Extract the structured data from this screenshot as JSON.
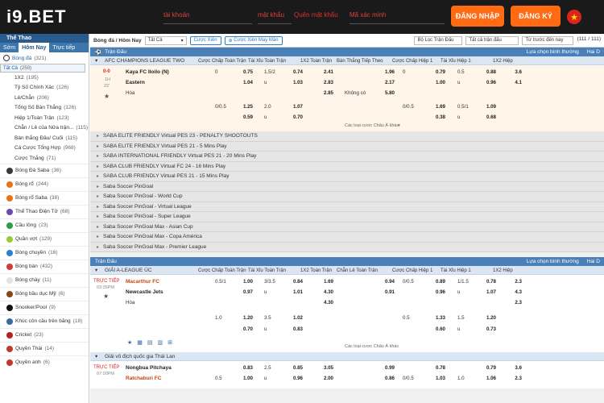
{
  "header": {
    "logo": "i9.BET",
    "username_placeholder": "tài khoản",
    "password_placeholder": "mật khẩu",
    "forgot_label": "Quên mật khẩu",
    "code_placeholder": "Mã xác minh",
    "login_label": "ĐĂNG NHẬP",
    "register_label": "ĐĂNG KÝ",
    "flag_icon": "star-icon"
  },
  "sidebar": {
    "title": "Thể Thao",
    "tabs": [
      "Sớm",
      "Hôm Nay",
      "Trực tiếp"
    ],
    "football_label": "Bóng đá",
    "football_count": "(321)",
    "sub": [
      {
        "label": "Tất Cả",
        "count": "(250)"
      },
      {
        "label": "1X2",
        "count": "(195)"
      },
      {
        "label": "Tỷ Số Chính Xác",
        "count": "(126)"
      },
      {
        "label": "Lẻ/Chẵn",
        "count": "(206)"
      },
      {
        "label": "Tổng Số Bàn Thắng",
        "count": "(126)"
      },
      {
        "label": "Hiệp 1/Toàn Trận",
        "count": "(123)"
      },
      {
        "label": "Chẵn / Lẻ của Nửa trận...",
        "count": "(115)"
      },
      {
        "label": "Bàn thắng Đầu/ Cuối",
        "count": "(115)"
      },
      {
        "label": "Cá Cược Tổng Hợp",
        "count": "(968)"
      },
      {
        "label": "Cược Thắng",
        "count": "(71)"
      }
    ],
    "sports": [
      {
        "label": "Bóng Đá Saba",
        "count": "(36)",
        "color": "#3a3a3a"
      },
      {
        "label": "Bóng rổ",
        "count": "(244)",
        "color": "#e8731a"
      },
      {
        "label": "Bóng rổ Saba",
        "count": "(38)",
        "color": "#e8731a"
      },
      {
        "label": "Thể Thao Điện Tử",
        "count": "(68)",
        "color": "#6a4caf"
      },
      {
        "label": "Cầu lông",
        "count": "(23)",
        "color": "#2a9d4a"
      },
      {
        "label": "Quần vợt",
        "count": "(129)",
        "color": "#9acd32"
      },
      {
        "label": "Bóng chuyền",
        "count": "(16)",
        "color": "#2d7fd0"
      },
      {
        "label": "Bóng bàn",
        "count": "(432)",
        "color": "#d23b3b"
      },
      {
        "label": "Bóng chày",
        "count": "(11)",
        "color": "#e2e2e2"
      },
      {
        "label": "Bóng bầu dục Mỹ",
        "count": "(6)",
        "color": "#8b4513"
      },
      {
        "label": "Snooker/Pool",
        "count": "(9)",
        "color": "#111111"
      },
      {
        "label": "Khúc côn cầu trên băng",
        "count": "(18)",
        "color": "#3a6aa0"
      },
      {
        "label": "Cricket",
        "count": "(23)",
        "color": "#b22222"
      },
      {
        "label": "Quyền Thái",
        "count": "(14)",
        "color": "#c0392b"
      },
      {
        "label": "Quyền anh",
        "count": "(6)",
        "color": "#c0392b"
      }
    ]
  },
  "toolbar": {
    "breadcrumb": "Bóng đá / Hôm Nay",
    "filter_all": "Tất Cả",
    "parlay": "Cược Xiên",
    "parlay_lucky": "Cược Xiên May Mắn",
    "league_filter": "Bộ Lọc Trận Đấu",
    "all_matches": "Tất cả trận đấu",
    "sort": "Từ trước đến nay",
    "count": "(111 / 111)"
  },
  "sections": {
    "live1": "Trận Đấu",
    "live2": "Trận Đấu",
    "odds_type": "Lựa chọn bình thường",
    "odds_type2": "Hai D"
  },
  "columns": [
    "Cược Chấp Toàn Trận",
    "Tài Xỉu Toàn Trận",
    "1X2 Toàn Trận",
    "Bàn Thắng Tiếp Theo",
    "Cược Chấp Hiệp 1",
    "Tài Xỉu Hiệp 1",
    "1X2 Hiệp"
  ],
  "columns2": [
    "Cược Chấp Toàn Trận",
    "Tài Xỉu Toàn Trận",
    "1X2 Toàn Trận",
    "Chẵn Lẻ Toàn Trận",
    "Cược Chấp Hiệp 1",
    "Tài Xỉu Hiệp 1",
    "1X2 Hiệp"
  ],
  "match1": {
    "league": "AFC CHAMPIONS LEAGUE TWO",
    "score": "0-0",
    "half": "1H",
    "minute": "22'",
    "home": "Kaya FC Iloilo (N)",
    "away": "Eastern",
    "draw": "Hòa",
    "more": "Các loại cược Châu Á khác",
    "r1": [
      "0",
      "0.75",
      "1.5/2",
      "0.74",
      "2.41",
      "1.96",
      "0",
      "0.79",
      "0.5",
      "0.88",
      "3.6"
    ],
    "r2": [
      "",
      "1.04",
      "u",
      "1.03",
      "2.83",
      "2.17",
      "",
      "1.00",
      "u",
      "0.96",
      "4.1"
    ],
    "r3": [
      "2.85",
      "Không có",
      "5.80"
    ],
    "r4": [
      "0/0.5",
      "1.25",
      "2.0",
      "1.07",
      "0/0.5",
      "1.69",
      "0.5/1",
      "1.09"
    ],
    "r5": [
      "0.59",
      "u",
      "0.70",
      "0.38",
      "u",
      "0.68"
    ]
  },
  "groups": [
    "SABA ELITE FRIENDLY Virtual PES 23 - PENALTY SHOOTOUTS",
    "SABA ELITE FRIENDLY Virtual PES 21 - 5 Mins Play",
    "SABA INTERNATIONAL FRIENDLY Virtual PES 21 - 20 Mins Play",
    "SABA CLUB FRIENDLY Virtual FC 24 - 16 Mins Play",
    "SABA CLUB FRIENDLY Virtual PES 21 - 15 Mins Play",
    "Saba Soccer PinGoal",
    "Saba Soccer PinGoal - World Cup",
    "Saba Soccer PinGoal - Virtual League",
    "Saba Soccer PinGoal - Super League",
    "Saba Soccer PinGoal Max - Asian Cup",
    "Saba Soccer PinGoal Max - Copa América",
    "Saba Soccer PinGoal Max - Premier League"
  ],
  "match2": {
    "league": "GIẢI A-LEAGUE ÚC",
    "live": "TRỰC TIẾP",
    "time": "03:35PM",
    "home": "Macarthur FC",
    "away": "Newcastle Jets",
    "draw": "Hòa",
    "more": "Các loại cược Châu Á khác",
    "r1": [
      "0.5/1",
      "1.00",
      "3/3.5",
      "0.84",
      "1.69",
      "0.94",
      "0/0.5",
      "0.89",
      "1/1.5",
      "0.78",
      "2.3"
    ],
    "r2": [
      "",
      "0.97",
      "u",
      "1.01",
      "4.30",
      "0.91",
      "",
      "0.96",
      "u",
      "1.07",
      "4.3"
    ],
    "r3": [
      "4.30",
      "2.3"
    ],
    "r4": [
      "1.0",
      "1.20",
      "3.5",
      "1.02",
      "0.5",
      "1.33",
      "1.5",
      "1.20"
    ],
    "r5": [
      "0.70",
      "u",
      "0.83",
      "0.60",
      "u",
      "0.73"
    ]
  },
  "match3": {
    "league": "Giải vô địch quốc gia Thái Lan",
    "live": "TRỰC TIẾP",
    "time": "07:00PM",
    "home": "Nongbua Pitchaya",
    "away": "Ratchaburi FC",
    "r1": [
      "0.83",
      "2.5",
      "0.85",
      "3.05",
      "0.99",
      "0.78",
      "0.79",
      "3.6"
    ],
    "r2": [
      "0.5",
      "1.00",
      "u",
      "0.96",
      "2.00",
      "0.86",
      "0/0.5",
      "1.03",
      "1.0",
      "1.06",
      "2.3"
    ]
  }
}
